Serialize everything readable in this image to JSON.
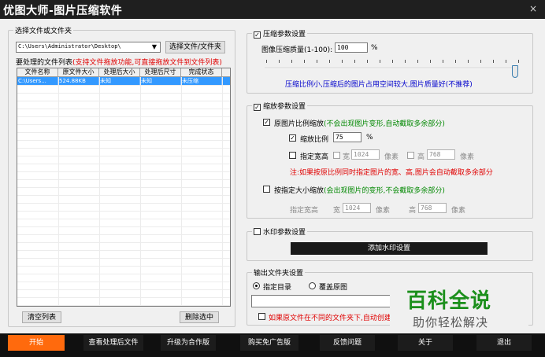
{
  "window": {
    "title": "优图大师-图片压缩软件",
    "close_glyph": "×"
  },
  "left": {
    "source_group_title": "选择文件或文件夹",
    "path_value": "C:\\Users\\Administrator\\Desktop\\",
    "select_button": "选择文件/文件夹",
    "list_label": "要处理的文件列表",
    "list_hint": "(支持文件拖放功能,可直接拖放文件到文件列表)",
    "columns": [
      "文件名称",
      "原文件大小",
      "处理后大小",
      "处理后尺寸",
      "完成状态"
    ],
    "rows": [
      {
        "name": "C:\\Users...",
        "orig_size": "524.88KB",
        "new_size": "未知",
        "new_dim": "未知",
        "status": "未压缩"
      }
    ],
    "clear_button": "清空列表",
    "delete_button": "删除选中"
  },
  "compress": {
    "title": "压缩参数设置",
    "checked": true,
    "quality_label": "图像压缩质量(1-100):",
    "quality_value": "100",
    "quality_unit": "%",
    "slider_value": 100,
    "hint": "压缩比例小,压缩后的图片占用空间较大,图片质量好(不推荐)"
  },
  "scale": {
    "title": "缩放参数设置",
    "checked": true,
    "proportional_label": "原图片比例缩放",
    "proportional_hint": "(不会出现图片变形,自动截取多余部分)",
    "proportional_checked": true,
    "ratio_label": "缩放比例",
    "ratio_checked": true,
    "ratio_value": "75",
    "ratio_unit": "%",
    "wh_label": "指定宽高",
    "width_label": "宽",
    "width_value": "1024",
    "px": "像素",
    "height_label": "高",
    "height_value": "768",
    "note": "注:如果按原比例同时指定图片的宽、高,图片会自动截取多余部分",
    "fixed_label": "按指定大小缩放",
    "fixed_hint": "(会出现图片的变形,不会截取多余部分)",
    "fixed_wh_label": "指定宽高",
    "fixed_width_label": "宽",
    "fixed_width_value": "1024",
    "fixed_height_label": "高",
    "fixed_height_value": "768"
  },
  "watermark": {
    "title": "水印参数设置",
    "button": "添加水印设置"
  },
  "output": {
    "title": "输出文件夹设置",
    "opt_dir": "指定目录",
    "opt_overwrite": "覆盖原图",
    "path_value": "",
    "keep_structure_label": "如果原文件在不同的文件夹下,自动创建"
  },
  "bottom_buttons": [
    "开始",
    "查看处理后文件",
    "升级为合作版",
    "购买免广告版",
    "反馈问题",
    "关于",
    "退出"
  ],
  "overlay": {
    "main": "百科全说",
    "sub": "助你轻松解决"
  },
  "colors": {
    "accent": "#ff6a0d",
    "selection": "#3399ff",
    "hint_blue": "#0000cc",
    "hint_red": "#e00000",
    "hint_green": "#008800"
  }
}
